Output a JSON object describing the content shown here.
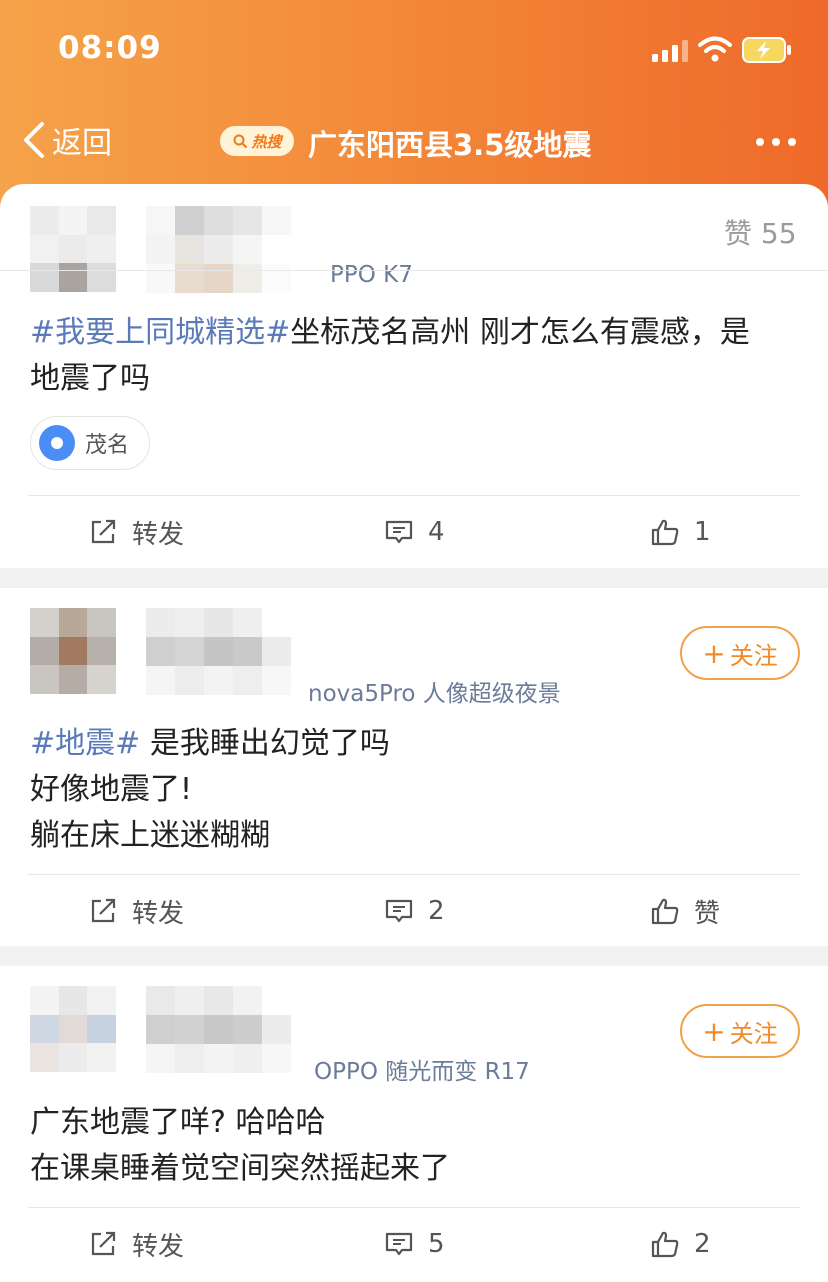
{
  "status": {
    "time": "08:09"
  },
  "nav": {
    "back_label": "返回",
    "hot_badge": "热搜",
    "title": "广东阳西县3.5级地震"
  },
  "posts": [
    {
      "device": "PPO K7",
      "likes_top": "赞 55",
      "tag": "#我要上同城精选#",
      "text_after_tag": "坐标茂名高州 刚才怎么有震感，是\n地震了吗",
      "location": "茂名",
      "actions": {
        "share": "转发",
        "comments": "4",
        "likes": "1"
      }
    },
    {
      "device": "nova5Pro 人像超级夜景",
      "follow": "关注",
      "tag": "#地震#",
      "text_after_tag": " 是我睡出幻觉了吗\n好像地震了!\n躺在床上迷迷糊糊",
      "actions": {
        "share": "转发",
        "comments": "2",
        "likes": "赞"
      }
    },
    {
      "device": "OPPO 随光而变 R17",
      "follow": "关注",
      "text": "广东地震了咩? 哈哈哈\n在课桌睡着觉空间突然摇起来了",
      "actions": {
        "share": "转发",
        "comments": "5",
        "likes": "2"
      }
    }
  ],
  "colors": {
    "header_start": "#f5a34a",
    "header_end": "#ef6a2a",
    "topic": "#5a7bb8",
    "follow": "#f08a2a"
  }
}
